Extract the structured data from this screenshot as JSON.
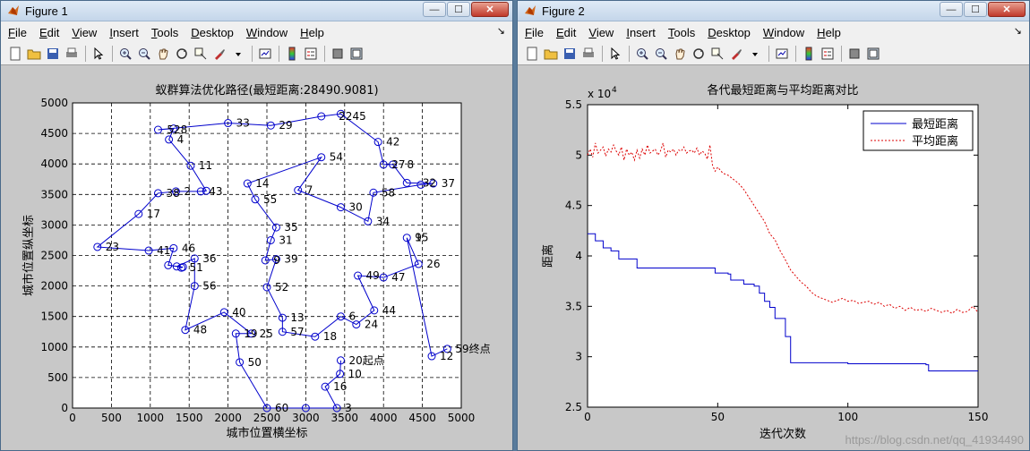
{
  "figure1": {
    "title": "Figure 1",
    "menus": [
      "File",
      "Edit",
      "View",
      "Insert",
      "Tools",
      "Desktop",
      "Window",
      "Help"
    ],
    "chart_data": {
      "type": "line",
      "title": "蚁群算法优化路径(最短距离:28490.9081)",
      "xlabel": "城市位置横坐标",
      "ylabel": "城市位置纵坐标",
      "xlim": [
        0,
        5000
      ],
      "ylim": [
        0,
        5000
      ],
      "xticks": [
        0,
        500,
        1000,
        1500,
        2000,
        2500,
        3000,
        3500,
        4000,
        4500,
        5000
      ],
      "yticks": [
        0,
        500,
        1000,
        1500,
        2000,
        2500,
        3000,
        3500,
        4000,
        4500,
        5000
      ],
      "grid": true,
      "route": [
        [
          3450,
          780
        ],
        [
          3440,
          560
        ],
        [
          3250,
          350
        ],
        [
          3400,
          0
        ],
        [
          3000,
          0
        ],
        [
          2500,
          0
        ],
        [
          2150,
          750
        ],
        [
          2100,
          1220
        ],
        [
          2300,
          1220
        ],
        [
          1950,
          1570
        ],
        [
          1450,
          1280
        ],
        [
          1570,
          2000
        ],
        [
          1570,
          2450
        ],
        [
          1340,
          2320
        ],
        [
          1400,
          2300
        ],
        [
          1420,
          2310
        ],
        [
          1230,
          2340
        ],
        [
          1300,
          2620
        ],
        [
          980,
          2580
        ],
        [
          320,
          2640
        ],
        [
          850,
          3180
        ],
        [
          1100,
          3520
        ],
        [
          1330,
          3550
        ],
        [
          1650,
          3550
        ],
        [
          1720,
          3560
        ],
        [
          1520,
          3970
        ],
        [
          1240,
          4400
        ],
        [
          1300,
          4580
        ],
        [
          1100,
          4560
        ],
        [
          2000,
          4670
        ],
        [
          2550,
          4630
        ],
        [
          3200,
          4780
        ],
        [
          3450,
          4820
        ],
        [
          3930,
          4360
        ],
        [
          4000,
          3990
        ],
        [
          4120,
          3990
        ],
        [
          4300,
          3690
        ],
        [
          4640,
          3680
        ],
        [
          4480,
          3660
        ],
        [
          3870,
          3530
        ],
        [
          3800,
          3060
        ],
        [
          3450,
          3290
        ],
        [
          2900,
          3570
        ],
        [
          3200,
          4110
        ],
        [
          2250,
          3680
        ],
        [
          2350,
          3420
        ],
        [
          2620,
          2960
        ],
        [
          2550,
          2750
        ],
        [
          2480,
          2420
        ],
        [
          2620,
          2440
        ],
        [
          2500,
          1980
        ],
        [
          2700,
          1480
        ],
        [
          2700,
          1250
        ],
        [
          3120,
          1170
        ],
        [
          3450,
          1500
        ],
        [
          3650,
          1370
        ],
        [
          3880,
          1600
        ],
        [
          3670,
          2170
        ],
        [
          4000,
          2140
        ],
        [
          4450,
          2360
        ],
        [
          4300,
          2790
        ],
        [
          4620,
          850
        ],
        [
          4820,
          970
        ]
      ],
      "labels": [
        {
          "text": "20起点",
          "x": 3450,
          "y": 780
        },
        {
          "text": "10",
          "x": 3440,
          "y": 560
        },
        {
          "text": "16",
          "x": 3250,
          "y": 350
        },
        {
          "text": "3",
          "x": 3400,
          "y": 0
        },
        {
          "text": "60",
          "x": 2500,
          "y": 0
        },
        {
          "text": "50",
          "x": 2150,
          "y": 750
        },
        {
          "text": "19",
          "x": 2100,
          "y": 1220
        },
        {
          "text": "25",
          "x": 2300,
          "y": 1220
        },
        {
          "text": "40",
          "x": 1950,
          "y": 1570
        },
        {
          "text": "48",
          "x": 1450,
          "y": 1280
        },
        {
          "text": "56",
          "x": 1570,
          "y": 2000
        },
        {
          "text": "36",
          "x": 1570,
          "y": 2450
        },
        {
          "text": "51",
          "x": 1400,
          "y": 2300
        },
        {
          "text": "46",
          "x": 1300,
          "y": 2620
        },
        {
          "text": "41",
          "x": 980,
          "y": 2580
        },
        {
          "text": "23",
          "x": 320,
          "y": 2640
        },
        {
          "text": "17",
          "x": 850,
          "y": 3180
        },
        {
          "text": "38",
          "x": 1100,
          "y": 3520
        },
        {
          "text": "2",
          "x": 1330,
          "y": 3550
        },
        {
          "text": "43",
          "x": 1650,
          "y": 3550
        },
        {
          "text": "11",
          "x": 1520,
          "y": 3970
        },
        {
          "text": "4",
          "x": 1240,
          "y": 4400
        },
        {
          "text": "528",
          "x": 1110,
          "y": 4560
        },
        {
          "text": "33",
          "x": 2000,
          "y": 4670
        },
        {
          "text": "29",
          "x": 2550,
          "y": 4630
        },
        {
          "text": "2245",
          "x": 3320,
          "y": 4780
        },
        {
          "text": "42",
          "x": 3930,
          "y": 4360
        },
        {
          "text": "27",
          "x": 4000,
          "y": 3990
        },
        {
          "text": "8",
          "x": 4200,
          "y": 3990
        },
        {
          "text": "32",
          "x": 4400,
          "y": 3690
        },
        {
          "text": "37",
          "x": 4640,
          "y": 3680
        },
        {
          "text": "58",
          "x": 3870,
          "y": 3530
        },
        {
          "text": "34",
          "x": 3800,
          "y": 3060
        },
        {
          "text": "30",
          "x": 3450,
          "y": 3290
        },
        {
          "text": "7",
          "x": 2900,
          "y": 3570
        },
        {
          "text": "54",
          "x": 3200,
          "y": 4110
        },
        {
          "text": "14",
          "x": 2250,
          "y": 3680
        },
        {
          "text": "55",
          "x": 2350,
          "y": 3420
        },
        {
          "text": "35",
          "x": 2620,
          "y": 2960
        },
        {
          "text": "31",
          "x": 2550,
          "y": 2750
        },
        {
          "text": "9",
          "x": 2480,
          "y": 2420
        },
        {
          "text": "39",
          "x": 2620,
          "y": 2440
        },
        {
          "text": "52",
          "x": 2500,
          "y": 1980
        },
        {
          "text": "13",
          "x": 2700,
          "y": 1480
        },
        {
          "text": "57",
          "x": 2700,
          "y": 1250
        },
        {
          "text": "18",
          "x": 3120,
          "y": 1170
        },
        {
          "text": "6",
          "x": 3450,
          "y": 1500
        },
        {
          "text": "24",
          "x": 3650,
          "y": 1370
        },
        {
          "text": "44",
          "x": 3880,
          "y": 1600
        },
        {
          "text": "49",
          "x": 3670,
          "y": 2170
        },
        {
          "text": "47",
          "x": 4000,
          "y": 2140
        },
        {
          "text": "26",
          "x": 4450,
          "y": 2360
        },
        {
          "text": "15",
          "x": 4300,
          "y": 2790
        },
        {
          "text": "9",
          "x": 4300,
          "y": 2790
        },
        {
          "text": "12",
          "x": 4620,
          "y": 850
        },
        {
          "text": "59终点",
          "x": 4820,
          "y": 970
        }
      ]
    }
  },
  "figure2": {
    "title": "Figure 2",
    "menus": [
      "File",
      "Edit",
      "View",
      "Insert",
      "Tools",
      "Desktop",
      "Window",
      "Help"
    ],
    "chart_data": {
      "type": "line",
      "title": "各代最短距离与平均距离对比",
      "xlabel": "迭代次数",
      "ylabel": "距离",
      "exponent_label": "x 10",
      "exponent": "4",
      "xlim": [
        0,
        150
      ],
      "ylim": [
        2.5,
        5.5
      ],
      "xticks": [
        0,
        50,
        100,
        150
      ],
      "yticks": [
        2.5,
        3,
        3.5,
        4,
        4.5,
        5,
        5.5
      ],
      "legend_position": "top-right",
      "series": [
        {
          "name": "最短距离",
          "color": "#0000cc",
          "style": "solid",
          "x": [
            0,
            2,
            3,
            5,
            6,
            8,
            9,
            11,
            12,
            13,
            18,
            19,
            22,
            27,
            29,
            42,
            44,
            48,
            49,
            50,
            52,
            54,
            55,
            57,
            60,
            62,
            64,
            66,
            68,
            70,
            72,
            75,
            76,
            78,
            80,
            85,
            90,
            95,
            100,
            110,
            120,
            125,
            130,
            131,
            140,
            150
          ],
          "y": [
            4.22,
            4.22,
            4.15,
            4.15,
            4.08,
            4.08,
            4.05,
            4.05,
            3.97,
            3.97,
            3.97,
            3.88,
            3.88,
            3.88,
            3.88,
            3.88,
            3.88,
            3.88,
            3.83,
            3.83,
            3.83,
            3.82,
            3.76,
            3.76,
            3.72,
            3.72,
            3.7,
            3.63,
            3.55,
            3.49,
            3.38,
            3.38,
            3.2,
            2.94,
            2.94,
            2.94,
            2.94,
            2.94,
            2.93,
            2.93,
            2.93,
            2.93,
            2.92,
            2.86,
            2.86,
            2.86
          ]
        },
        {
          "name": "平均距离",
          "color": "#dd0000",
          "style": "dashed",
          "x": [
            0,
            1,
            2,
            3,
            4,
            5,
            6,
            7,
            8,
            9,
            10,
            11,
            12,
            13,
            14,
            15,
            16,
            17,
            18,
            19,
            20,
            21,
            22,
            23,
            24,
            25,
            26,
            27,
            28,
            29,
            30,
            31,
            32,
            33,
            34,
            35,
            36,
            37,
            38,
            39,
            40,
            41,
            42,
            43,
            44,
            45,
            46,
            47,
            48,
            49,
            50,
            52,
            54,
            56,
            58,
            60,
            62,
            64,
            66,
            68,
            70,
            72,
            74,
            76,
            78,
            80,
            82,
            84,
            86,
            88,
            90,
            92,
            94,
            96,
            98,
            100,
            102,
            104,
            106,
            108,
            110,
            112,
            114,
            116,
            118,
            120,
            122,
            124,
            126,
            128,
            130,
            132,
            134,
            136,
            138,
            140,
            142,
            144,
            146,
            148,
            150
          ],
          "y": [
            5.0,
            5.06,
            4.98,
            5.12,
            5.02,
            5.05,
            5.08,
            4.99,
            5.06,
            5.03,
            5.1,
            5.04,
            5.0,
            5.08,
            4.95,
            5.06,
            5.0,
            5.03,
            4.95,
            5.05,
            4.97,
            5.06,
            5.0,
            5.1,
            5.02,
            5.04,
            5.06,
            5.0,
            5.04,
            5.12,
            4.98,
            5.05,
            5.03,
            5.06,
            5.0,
            5.05,
            5.04,
            5.08,
            5.02,
            5.04,
            5.05,
            5.02,
            5.07,
            5.0,
            5.04,
            5.02,
            4.96,
            5.1,
            4.9,
            4.84,
            4.88,
            4.82,
            4.8,
            4.76,
            4.72,
            4.66,
            4.58,
            4.5,
            4.42,
            4.34,
            4.22,
            4.16,
            4.05,
            3.96,
            3.86,
            3.8,
            3.74,
            3.7,
            3.64,
            3.6,
            3.58,
            3.56,
            3.54,
            3.56,
            3.58,
            3.55,
            3.56,
            3.53,
            3.54,
            3.55,
            3.52,
            3.54,
            3.5,
            3.52,
            3.48,
            3.5,
            3.46,
            3.49,
            3.46,
            3.47,
            3.45,
            3.48,
            3.46,
            3.44,
            3.46,
            3.43,
            3.47,
            3.44,
            3.45,
            3.5,
            3.44
          ]
        }
      ]
    }
  },
  "watermark": "https://blog.csdn.net/qq_41934490"
}
